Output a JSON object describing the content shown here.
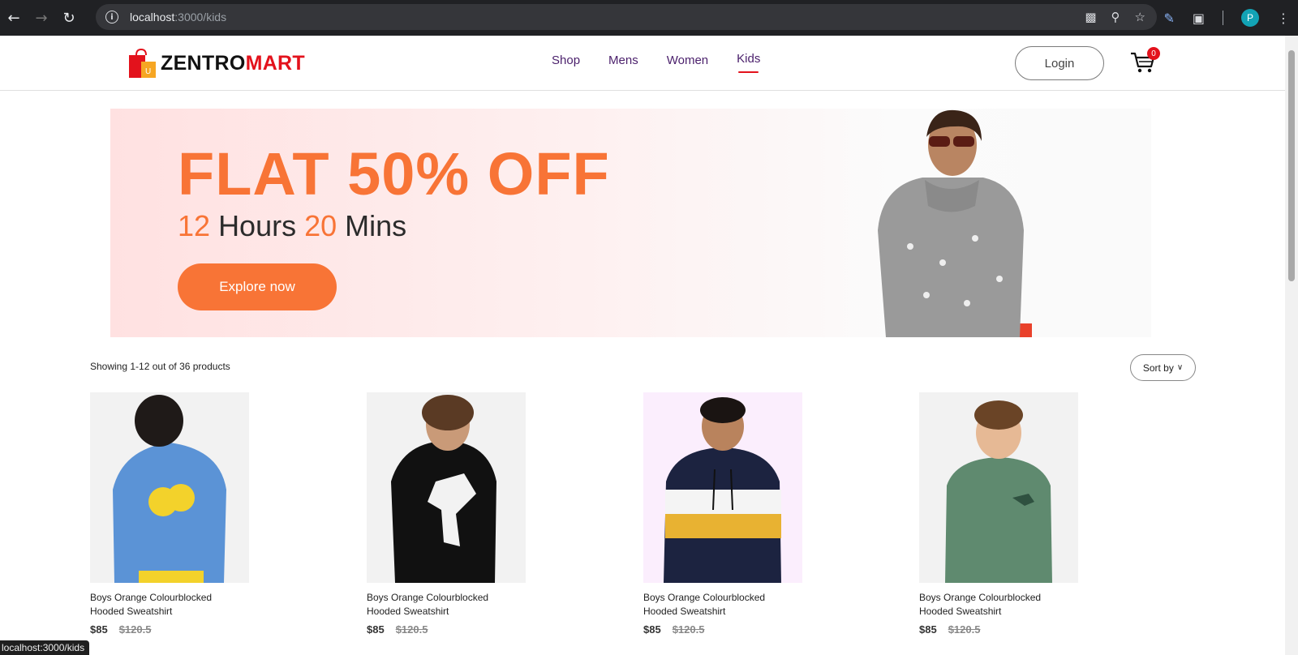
{
  "browser": {
    "url_host": "localhost",
    "url_rest": ":3000/kids",
    "profile_initial": "P",
    "status_url": "localhost:3000/kids"
  },
  "site": {
    "logo_part1": "ZENTRO",
    "logo_part2": "MART",
    "nav": [
      {
        "label": "Shop"
      },
      {
        "label": "Mens"
      },
      {
        "label": "Women"
      },
      {
        "label": "Kids"
      }
    ],
    "login_label": "Login",
    "cart_count": "0"
  },
  "hero": {
    "title": "FLAT 50% OFF",
    "hours": "12",
    "hours_label": "Hours",
    "mins": "20",
    "mins_label": "Mins",
    "cta": "Explore now"
  },
  "listing": {
    "showing": "Showing 1-12 out of 36 products",
    "sort_label": "Sort by"
  },
  "products": [
    {
      "name_line1": "Boys Orange Colourblocked",
      "name_line2": "Hooded Sweatshirt",
      "price": "$85",
      "old_price": "$120.5"
    },
    {
      "name_line1": "Boys Orange Colourblocked",
      "name_line2": "Hooded Sweatshirt",
      "price": "$85",
      "old_price": "$120.5"
    },
    {
      "name_line1": "Boys Orange Colourblocked",
      "name_line2": "Hooded Sweatshirt",
      "price": "$85",
      "old_price": "$120.5"
    },
    {
      "name_line1": "Boys Orange Colourblocked",
      "name_line2": "Hooded Sweatshirt",
      "price": "$85",
      "old_price": "$120.5"
    }
  ],
  "colors": {
    "accent": "#f87436",
    "brand_red": "#e3121c",
    "nav_purple": "#4a1f6b"
  }
}
